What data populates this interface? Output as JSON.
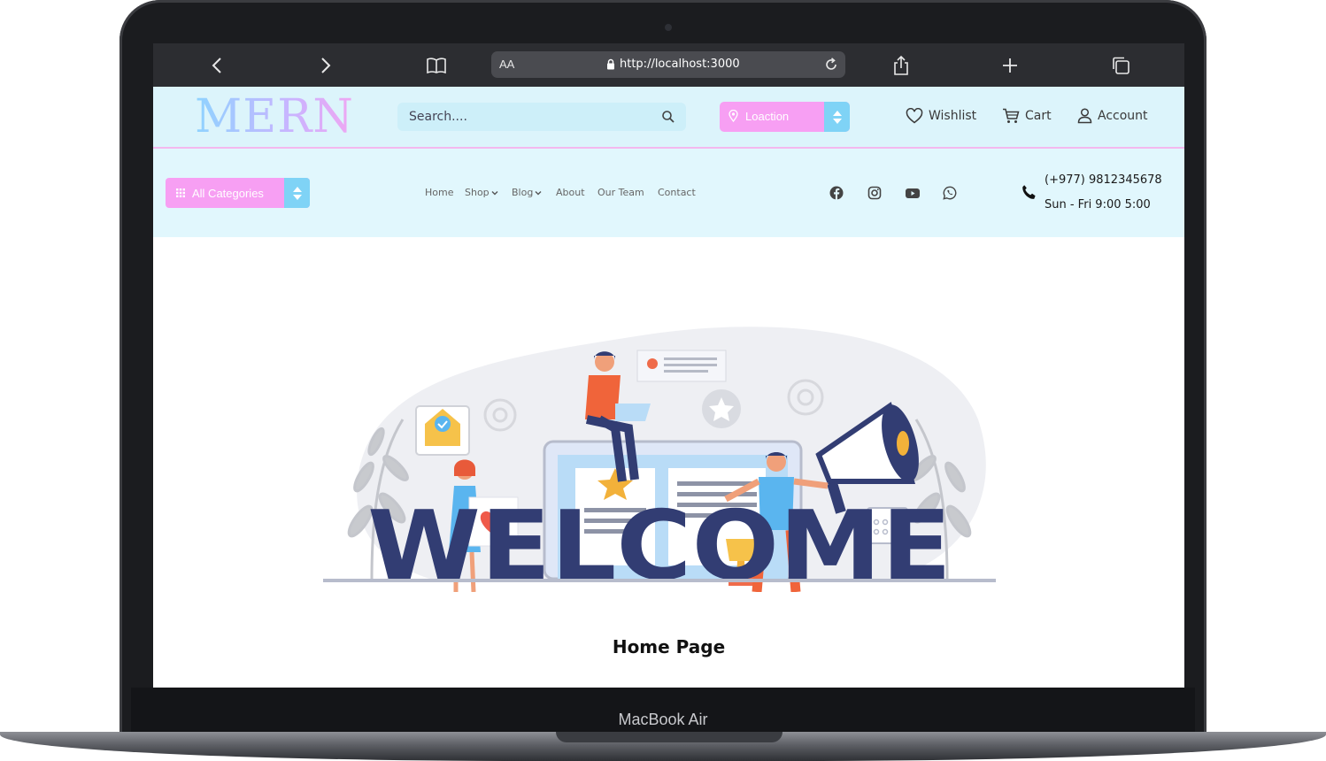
{
  "device": {
    "label": "MacBook Air"
  },
  "browser": {
    "text_size_label": "AA",
    "url": "http://localhost:3000"
  },
  "header": {
    "logo": "MERN",
    "search": {
      "placeholder": "Search...."
    },
    "location": {
      "label": "Loaction"
    },
    "links": {
      "wishlist": "Wishlist",
      "cart": "Cart",
      "account": "Account"
    }
  },
  "nav": {
    "categories_label": "All Categories",
    "items": [
      {
        "label": "Home",
        "dropdown": false
      },
      {
        "label": "Shop",
        "dropdown": true
      },
      {
        "label": "Blog",
        "dropdown": true
      },
      {
        "label": "About",
        "dropdown": false
      },
      {
        "label": "Our Team",
        "dropdown": false
      },
      {
        "label": "Contact",
        "dropdown": false
      }
    ],
    "social_icons": [
      "facebook-icon",
      "instagram-icon",
      "youtube-icon",
      "whatsapp-icon"
    ],
    "contact": {
      "phone": "(+977) 9812345678",
      "hours": "Sun - Fri 9:00 5:00"
    }
  },
  "hero": {
    "banner_text": "WELCOME"
  },
  "main": {
    "title": "Home Page"
  },
  "colors": {
    "header_bg": "#dcf4fb",
    "nav_bg": "#e1f7fd",
    "accent_pink": "#f79ff3",
    "accent_blue": "#7fd3f6",
    "welcome_navy": "#323d73",
    "browser_chrome": "#2c2d31"
  }
}
